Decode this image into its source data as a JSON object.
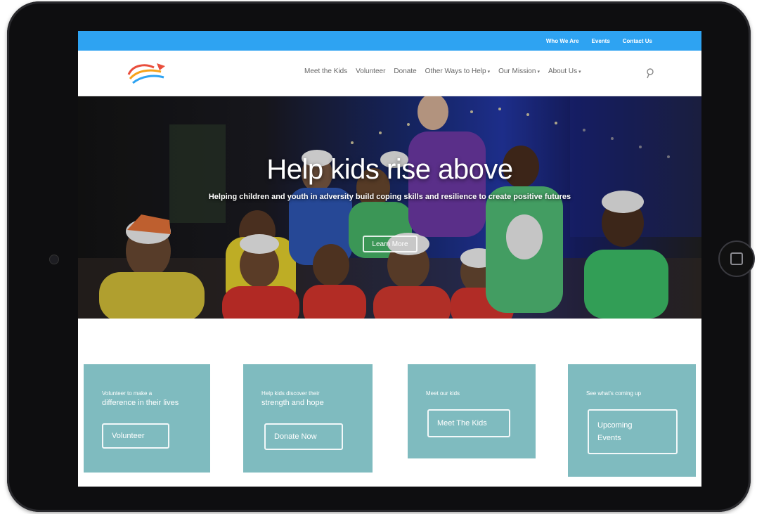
{
  "topbar": {
    "links": [
      "Who We Are",
      "Events",
      "Contact Us"
    ]
  },
  "nav": {
    "items": [
      {
        "label": "Meet the Kids",
        "dropdown": false
      },
      {
        "label": "Volunteer",
        "dropdown": false
      },
      {
        "label": "Donate",
        "dropdown": false
      },
      {
        "label": "Other Ways to Help",
        "dropdown": true
      },
      {
        "label": "Our Mission",
        "dropdown": true
      },
      {
        "label": "About Us",
        "dropdown": true
      }
    ]
  },
  "hero": {
    "title": "Help kids rise above",
    "subtitle": "Helping children and youth in adversity build coping skills and resilience to create positive futures",
    "button": "Learn More"
  },
  "cta": [
    {
      "line1": "Volunteer to make a",
      "line2": "difference in their lives",
      "button": "Volunteer"
    },
    {
      "line1": "Help kids discover their",
      "line2": "strength and hope",
      "button": "Donate Now"
    },
    {
      "line1": "Meet our kids",
      "line2": "",
      "button": "Meet The Kids"
    },
    {
      "line1": "See what's coming up",
      "line2": "",
      "button": "Upcoming Events"
    }
  ],
  "colors": {
    "topbar": "#2ea3f2",
    "cta_bg": "#7fbbbf",
    "tablet_frame": "#0e0e10"
  }
}
